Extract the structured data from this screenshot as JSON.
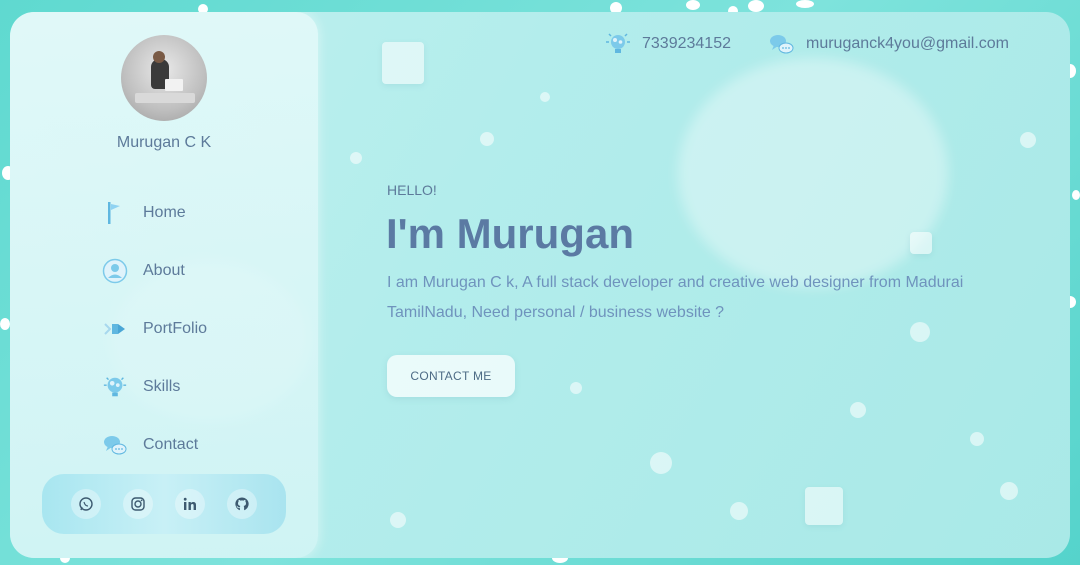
{
  "profile": {
    "name": "Murugan C K"
  },
  "nav": {
    "items": [
      {
        "label": "Home",
        "icon": "home-flag-icon"
      },
      {
        "label": "About",
        "icon": "user-icon"
      },
      {
        "label": "PortFolio",
        "icon": "portfolio-icon"
      },
      {
        "label": "Skills",
        "icon": "brain-icon"
      },
      {
        "label": "Contact",
        "icon": "chat-icon"
      }
    ]
  },
  "social": [
    "whatsapp-icon",
    "instagram-icon",
    "linkedin-icon",
    "github-icon"
  ],
  "header": {
    "phone": "7339234152",
    "email": "muruganck4you@gmail.com"
  },
  "hero": {
    "greeting": "HELLO!",
    "headline": "I'm Murugan",
    "description": "I am Murugan C k, A full stack developer and creative web designer from Madurai TamilNadu,   Need personal / business website ?",
    "cta_label": "CONTACT ME"
  },
  "colors": {
    "accent_text": "#5b7aa3",
    "body_text": "#6f93bd",
    "background": "#5fd9d0"
  }
}
